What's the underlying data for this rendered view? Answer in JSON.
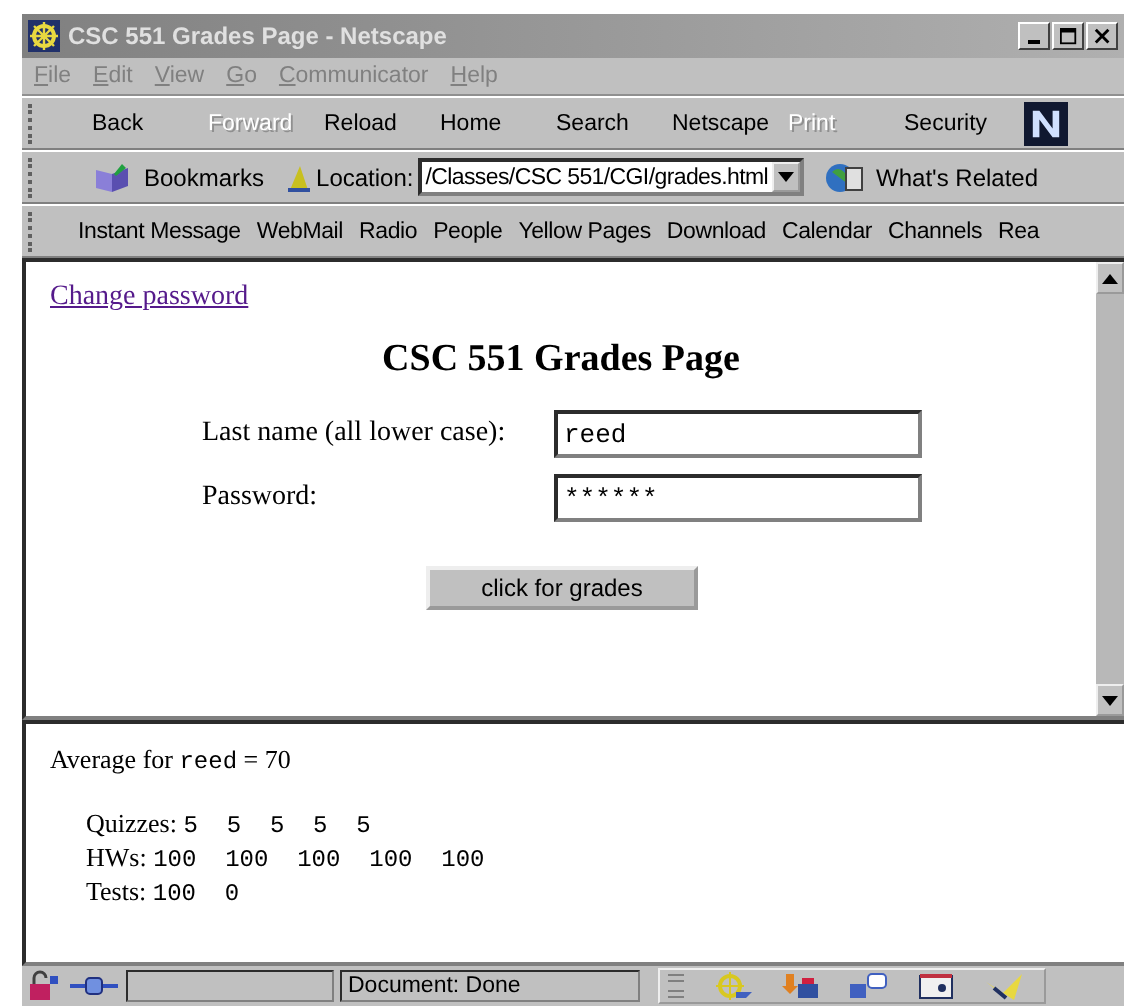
{
  "window": {
    "title": "CSC 551 Grades Page - Netscape"
  },
  "menu": [
    {
      "label": "File"
    },
    {
      "label": "Edit"
    },
    {
      "label": "View"
    },
    {
      "label": "Go"
    },
    {
      "label": "Communicator"
    },
    {
      "label": "Help"
    }
  ],
  "navigation_toolbar": [
    {
      "label": "Back",
      "disabled": false
    },
    {
      "label": "Forward",
      "disabled": true
    },
    {
      "label": "Reload",
      "disabled": false
    },
    {
      "label": "Home",
      "disabled": false
    },
    {
      "label": "Search",
      "disabled": false
    },
    {
      "label": "Netscape",
      "disabled": false
    },
    {
      "label": "Print",
      "disabled": true
    },
    {
      "label": "Security",
      "disabled": false
    }
  ],
  "location_bar": {
    "bookmarks": "Bookmarks",
    "location_label": "Location:",
    "url": "/Classes/CSC 551/CGI/grades.html",
    "related": "What's Related"
  },
  "personal_toolbar": [
    "Instant Message",
    "WebMail",
    "Radio",
    "People",
    "Yellow Pages",
    "Download",
    "Calendar",
    "Channels",
    "Rea"
  ],
  "page": {
    "link": "Change password",
    "heading": "CSC 551 Grades Page",
    "fields": [
      {
        "label": "Last name (all lower case):",
        "value": "reed"
      },
      {
        "label": "Password:",
        "value": "******"
      }
    ],
    "button": "click for grades"
  },
  "result": {
    "prefix": "Average for",
    "name": "reed",
    "suffix": "= 70",
    "grades": [
      {
        "label": "Quizzes:",
        "scores": "5  5  5  5  5"
      },
      {
        "label": "HWs:",
        "scores": "100  100  100  100  100"
      },
      {
        "label": "Tests:",
        "scores": "100  0"
      }
    ]
  },
  "status_bar": {
    "message": "Document: Done"
  }
}
